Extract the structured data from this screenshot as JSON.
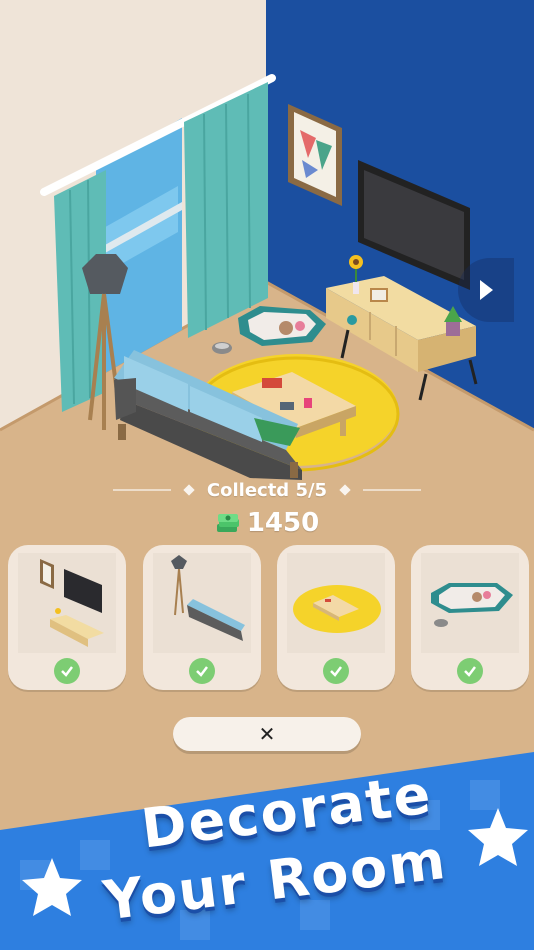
{
  "room": {
    "collected_text": "Collectd 5/5",
    "coins": "1450"
  },
  "nav": {
    "next_icon": "play-arrow-icon"
  },
  "items": [
    {
      "name": "tv-stand-set",
      "collected": true
    },
    {
      "name": "sofa-lamp-set",
      "collected": true
    },
    {
      "name": "rug-table-set",
      "collected": true
    },
    {
      "name": "pet-bed-set",
      "collected": true
    }
  ],
  "close_button": {
    "label": "✕"
  },
  "banner": {
    "line1": "Decorate",
    "line2": "Your Room"
  },
  "colors": {
    "wall_left": "#efe4d8",
    "wall_right": "#1b4fa0",
    "floor": "#d8b48a",
    "rug": "#f5d32a",
    "curtain": "#5fbcb6",
    "banner_blue": "#2e7fe0",
    "check_green": "#7dcd73"
  }
}
